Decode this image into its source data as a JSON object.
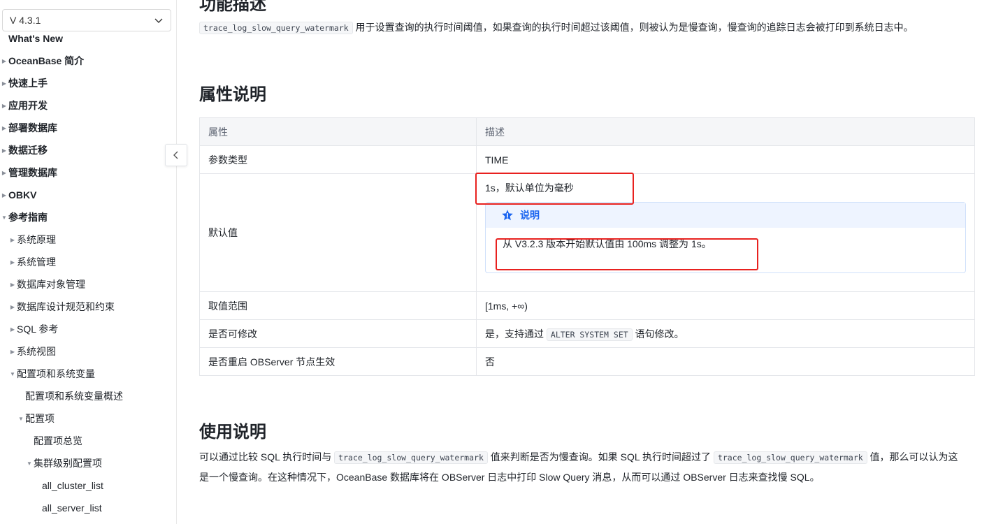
{
  "sidebar": {
    "version": "V 4.3.1",
    "items": [
      {
        "label": "What's New",
        "level": 0,
        "bold": true,
        "arrow": ""
      },
      {
        "label": "OceanBase 简介",
        "level": 0,
        "bold": true,
        "arrow": "right"
      },
      {
        "label": "快速上手",
        "level": 0,
        "bold": true,
        "arrow": "right"
      },
      {
        "label": "应用开发",
        "level": 0,
        "bold": true,
        "arrow": "right"
      },
      {
        "label": "部署数据库",
        "level": 0,
        "bold": true,
        "arrow": "right"
      },
      {
        "label": "数据迁移",
        "level": 0,
        "bold": true,
        "arrow": "right"
      },
      {
        "label": "管理数据库",
        "level": 0,
        "bold": true,
        "arrow": "right"
      },
      {
        "label": "OBKV",
        "level": 0,
        "bold": true,
        "arrow": "right"
      },
      {
        "label": "参考指南",
        "level": 0,
        "bold": true,
        "arrow": "down"
      },
      {
        "label": "系统原理",
        "level": 1,
        "bold": false,
        "arrow": "right"
      },
      {
        "label": "系统管理",
        "level": 1,
        "bold": false,
        "arrow": "right"
      },
      {
        "label": "数据库对象管理",
        "level": 1,
        "bold": false,
        "arrow": "right"
      },
      {
        "label": "数据库设计规范和约束",
        "level": 1,
        "bold": false,
        "arrow": "right"
      },
      {
        "label": "SQL 参考",
        "level": 1,
        "bold": false,
        "arrow": "right"
      },
      {
        "label": "系统视图",
        "level": 1,
        "bold": false,
        "arrow": "right"
      },
      {
        "label": "配置项和系统变量",
        "level": 1,
        "bold": false,
        "arrow": "down"
      },
      {
        "label": "配置项和系统变量概述",
        "level": 2,
        "bold": false,
        "arrow": ""
      },
      {
        "label": "配置项",
        "level": 2,
        "bold": false,
        "arrow": "down"
      },
      {
        "label": "配置项总览",
        "level": 3,
        "bold": false,
        "arrow": ""
      },
      {
        "label": "集群级别配置项",
        "level": 3,
        "bold": false,
        "arrow": "down"
      },
      {
        "label": "all_cluster_list",
        "level": 4,
        "bold": false,
        "arrow": ""
      },
      {
        "label": "all_server_list",
        "level": 4,
        "bold": false,
        "arrow": ""
      }
    ]
  },
  "content": {
    "top_heading": "功能描述",
    "desc": {
      "code": "trace_log_slow_query_watermark",
      "text": " 用于设置查询的执行时间阈值，如果查询的执行时间超过该阈值，则被认为是慢查询，慢查询的追踪日志会被打印到系统日志中。"
    },
    "attr_heading": "属性说明",
    "table": {
      "headers": [
        "属性",
        "描述"
      ],
      "row_type": {
        "k": "参数类型",
        "v": "TIME"
      },
      "row_default": {
        "k": "默认值",
        "v": "1s，默认单位为毫秒"
      },
      "note_title": "说明",
      "note_text": "从 V3.2.3 版本开始默认值由 100ms 调整为 1s。",
      "row_range": {
        "k": "取值范围",
        "v": "[1ms, +∞)"
      },
      "row_modify": {
        "k": "是否可修改",
        "v_pre": "是，支持通过 ",
        "v_code": "ALTER SYSTEM SET",
        "v_post": " 语句修改。"
      },
      "row_restart": {
        "k": "是否重启 OBServer 节点生效",
        "v": "否"
      }
    },
    "usage_heading": "使用说明",
    "usage": {
      "t1": "可以通过比较 SQL 执行时间与 ",
      "code1": "trace_log_slow_query_watermark",
      "t2": " 值来判断是否为慢查询。如果 SQL 执行时间超过了 ",
      "code2": "trace_log_slow_query_watermark",
      "t3": " 值，那么可以认为这是一个慢查询。在这种情况下，OceanBase 数据库将在 OBServer 日志中打印 Slow Query 消息，从而可以通过 OBServer 日志来查找慢 SQL。"
    }
  },
  "colors": {
    "accent": "#1a64f0",
    "highlight": "#e8211f"
  }
}
